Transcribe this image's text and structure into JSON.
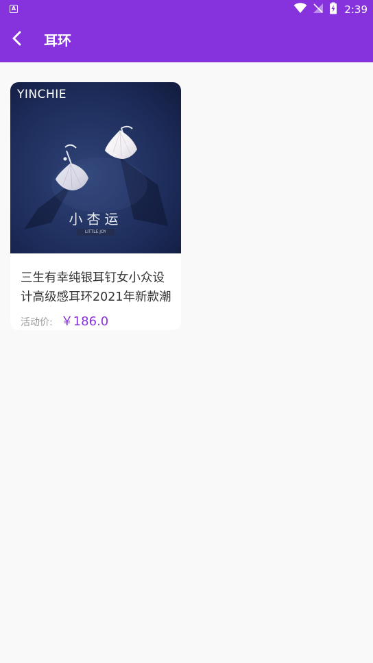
{
  "status_bar": {
    "app_icon": "A",
    "time": "2:39",
    "icons": [
      "wifi-icon",
      "no-signal-icon",
      "battery-charging-icon"
    ]
  },
  "header": {
    "title": "耳环",
    "back_icon": "chevron-left-icon"
  },
  "products": [
    {
      "image": {
        "brand": "YINCHIE",
        "cn_text": "小杏运",
        "en_text": "LITTLE JOY"
      },
      "name": "三生有幸纯银耳钉女小众设计高级感耳环2021年新款潮",
      "price_label": "活动价:",
      "price": "￥186.0"
    }
  ],
  "colors": {
    "primary": "#8633dd",
    "background": "#f9f9f9",
    "card": "#ffffff",
    "price": "#8633dd"
  }
}
